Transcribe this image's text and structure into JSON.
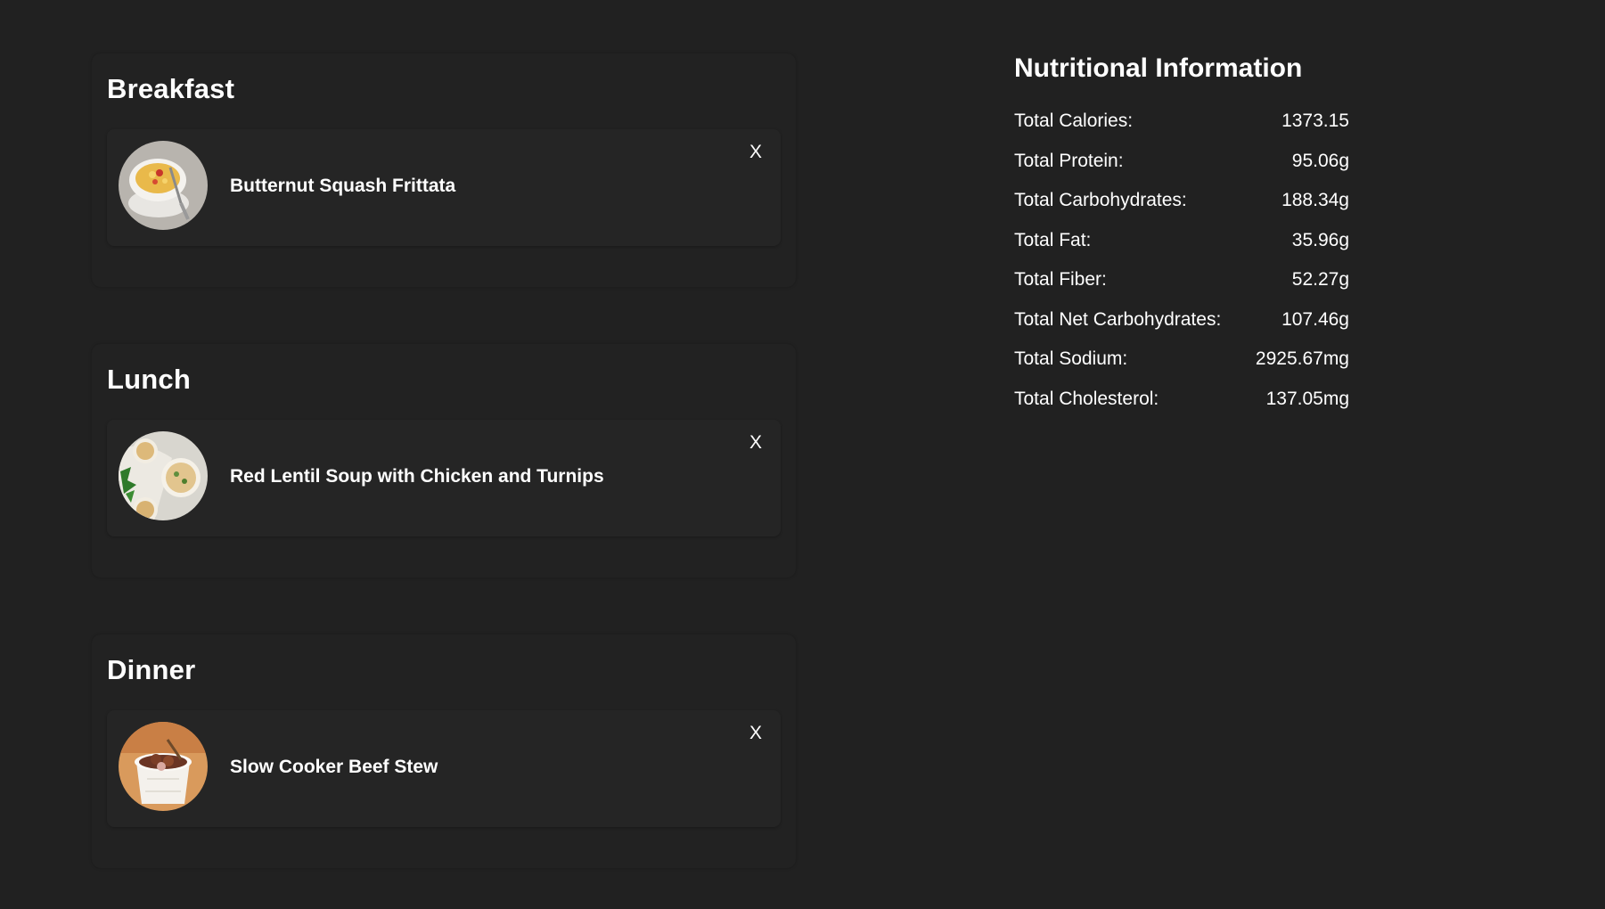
{
  "meals": [
    {
      "title": "Breakfast",
      "recipe": "Butternut Squash Frittata",
      "remove_label": "X",
      "image_icon": "frittata-bowl-photo"
    },
    {
      "title": "Lunch",
      "recipe": "Red Lentil Soup with Chicken and Turnips",
      "remove_label": "X",
      "image_icon": "lentil-soup-photo"
    },
    {
      "title": "Dinner",
      "recipe": "Slow Cooker Beef Stew",
      "remove_label": "X",
      "image_icon": "beef-stew-photo"
    }
  ],
  "nutrition": {
    "title": "Nutritional Information",
    "rows": [
      {
        "label": "Total Calories:",
        "value": "1373.15"
      },
      {
        "label": "Total Protein:",
        "value": "95.06g"
      },
      {
        "label": "Total Carbohydrates:",
        "value": "188.34g"
      },
      {
        "label": "Total Fat:",
        "value": "35.96g"
      },
      {
        "label": "Total Fiber:",
        "value": "52.27g"
      },
      {
        "label": "Total Net Carbohydrates:",
        "value": "107.46g"
      },
      {
        "label": "Total Sodium:",
        "value": "2925.67mg"
      },
      {
        "label": "Total Cholesterol:",
        "value": "137.05mg"
      }
    ]
  },
  "colors": {
    "background": "#212121",
    "card": "#252525",
    "text": "#ffffff"
  }
}
